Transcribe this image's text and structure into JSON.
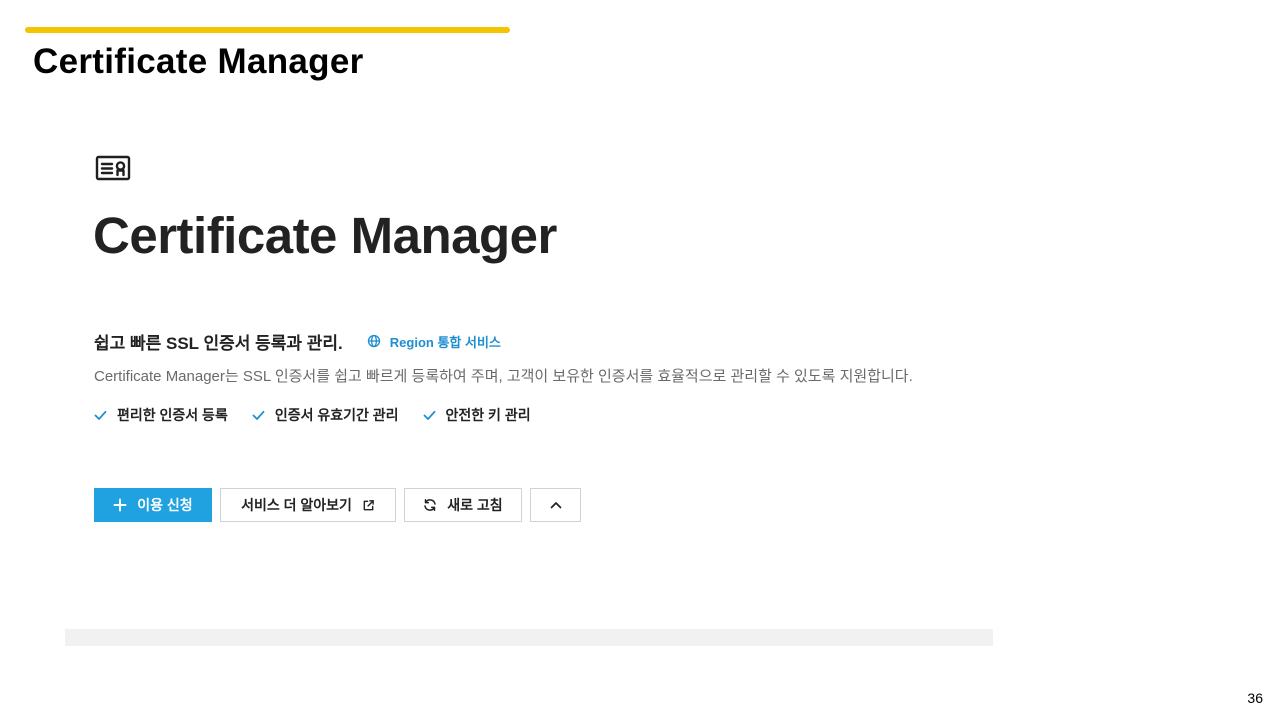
{
  "slide": {
    "title": "Certificate Manager",
    "page_number": "36",
    "accent_color": "#f5c400"
  },
  "product": {
    "icon": "certificate-icon",
    "title": "Certificate Manager",
    "tagline": "쉽고 빠른 SSL 인증서 등록과 관리.",
    "region_badge": {
      "icon": "globe-icon",
      "label": "Region 통합 서비스",
      "color": "#1e8fd0"
    },
    "description": "Certificate Manager는 SSL 인증서를 쉽고 빠르게 등록하여 주며, 고객이 보유한 인증서를 효율적으로 관리할 수 있도록 지원합니다.",
    "features": [
      {
        "icon": "check-icon",
        "label": "편리한 인증서 등록"
      },
      {
        "icon": "check-icon",
        "label": "인증서 유효기간 관리"
      },
      {
        "icon": "check-icon",
        "label": "안전한 키 관리"
      }
    ]
  },
  "actions": {
    "apply": {
      "icon": "plus-icon",
      "label": "이용 신청",
      "color": "#20a2e0"
    },
    "learn_more": {
      "label": "서비스 더 알아보기",
      "icon": "external-link-icon"
    },
    "refresh": {
      "icon": "refresh-icon",
      "label": "새로 고침"
    },
    "collapse": {
      "icon": "chevron-up-icon"
    }
  }
}
